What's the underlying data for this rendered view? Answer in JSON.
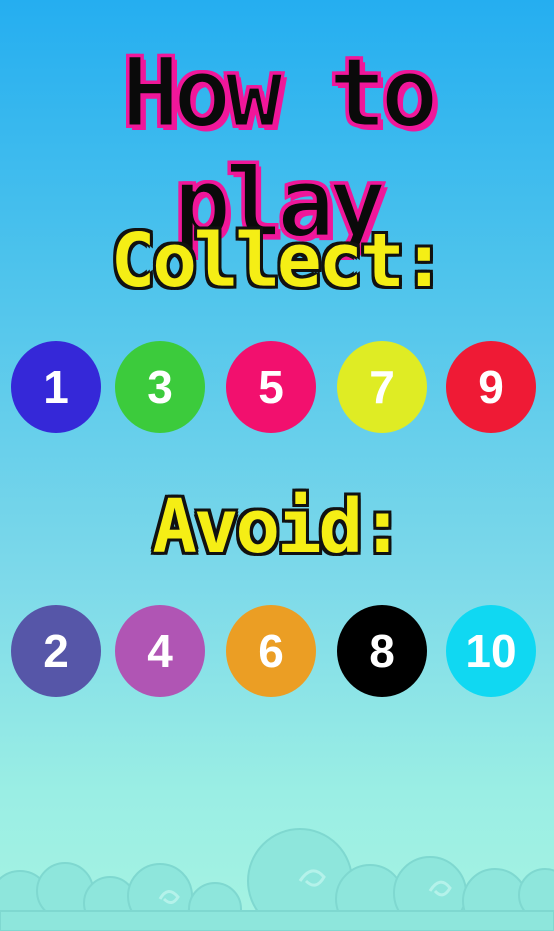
{
  "title": "How to play",
  "collect": {
    "label": "Collect:",
    "numbers": [
      {
        "value": "1",
        "color": "#3528d8"
      },
      {
        "value": "3",
        "color": "#3ccb3c"
      },
      {
        "value": "5",
        "color": "#f2106e"
      },
      {
        "value": "7",
        "color": "#dfec24"
      },
      {
        "value": "9",
        "color": "#ef1a35"
      }
    ]
  },
  "avoid": {
    "label": "Avoid:",
    "numbers": [
      {
        "value": "2",
        "color": "#5656a8"
      },
      {
        "value": "4",
        "color": "#b055b4"
      },
      {
        "value": "6",
        "color": "#eb9e24"
      },
      {
        "value": "8",
        "color": "#000000"
      },
      {
        "value": "10",
        "color": "#10d8f2"
      }
    ]
  },
  "colors": {
    "title_fill": "#0a0a0a",
    "title_outline": "#f0179a",
    "heading_fill": "#f5ee15",
    "heading_outline": "#111111"
  }
}
